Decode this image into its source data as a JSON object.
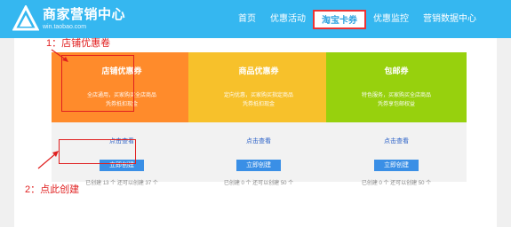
{
  "header": {
    "logo_title": "商家营销中心",
    "logo_url": "win.taobao.com"
  },
  "nav": {
    "items": [
      {
        "label": "首页"
      },
      {
        "label": "优惠活动"
      },
      {
        "label": "淘宝卡券"
      },
      {
        "label": "优惠监控"
      },
      {
        "label": "营销数据中心"
      }
    ],
    "active_index": 2
  },
  "cards": [
    {
      "title": "店铺优惠券",
      "desc_line1": "全店通用，买家购买全店商品",
      "desc_line2": "凭券抵扣现金",
      "link": "点击查看",
      "button": "立即创建",
      "stat": "已创建 13 个 还可以创建 37 个",
      "color": "#ff8b2b"
    },
    {
      "title": "商品优惠券",
      "desc_line1": "定向优惠，买家购买指定商品",
      "desc_line2": "凭券抵扣现金",
      "link": "点击查看",
      "button": "立即创建",
      "stat": "已创建 0 个 还可以创建 50 个",
      "color": "#f7c12b"
    },
    {
      "title": "包邮券",
      "desc_line1": "特色服务，买家购买全店商品",
      "desc_line2": "凭券享包邮权益",
      "link": "点击查看",
      "button": "立即创建",
      "stat": "已创建 0 个 还可以创建 50 个",
      "color": "#97d10d"
    }
  ],
  "annotations": {
    "step1": "1：店铺优惠卷",
    "step2": "2：点此创建",
    "color": "#e02020"
  },
  "colors": {
    "header_bg": "#35b7f0",
    "accent": "#3a8fe6"
  }
}
